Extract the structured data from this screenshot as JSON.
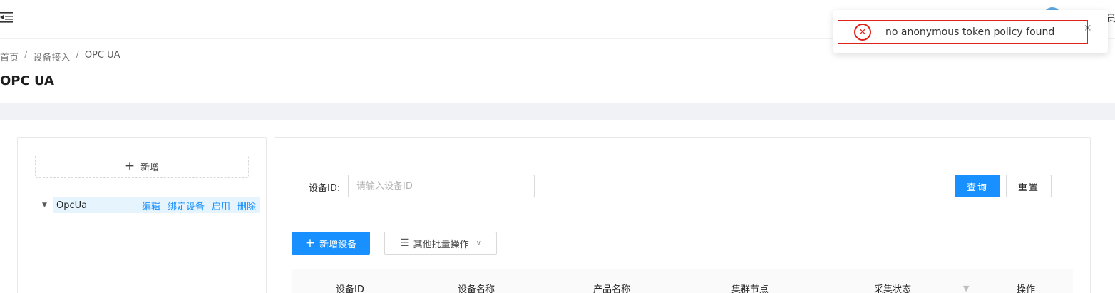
{
  "header": {
    "user_name": "员"
  },
  "breadcrumb": {
    "home": "首页",
    "section": "设备接入",
    "current": "OPC UA",
    "separator": "/"
  },
  "page": {
    "title": "OPC UA"
  },
  "left_panel": {
    "add_label": "新增",
    "tree": {
      "node_title": "OpcUa",
      "actions": {
        "edit": "编辑",
        "bind": "绑定设备",
        "enable": "启用",
        "delete": "删除"
      }
    }
  },
  "search": {
    "device_id_label": "设备ID:",
    "device_id_placeholder": "请输入设备ID",
    "device_id_value": "",
    "query_label": "查询",
    "reset_label": "重置"
  },
  "toolbar": {
    "add_device_label": "新增设备",
    "batch_label": "其他批量操作"
  },
  "table": {
    "columns": [
      "设备ID",
      "设备名称",
      "产品名称",
      "集群节点",
      "采集状态",
      "操作"
    ]
  },
  "notification": {
    "message": "no anonymous token policy found",
    "type": "error"
  },
  "icons": {
    "menu": "menu-fold-icon",
    "error": "close-circle-icon",
    "close": "close-icon",
    "plus": "plus-icon",
    "caret": "caret-down-icon",
    "batch": "unordered-list-icon",
    "chevron": "chevron-down-icon",
    "filter": "filter-icon"
  },
  "colors": {
    "primary": "#1890ff",
    "error": "#e0201a",
    "tree_selected_bg": "#e6f4fd",
    "page_bg": "#f0f2f5"
  }
}
